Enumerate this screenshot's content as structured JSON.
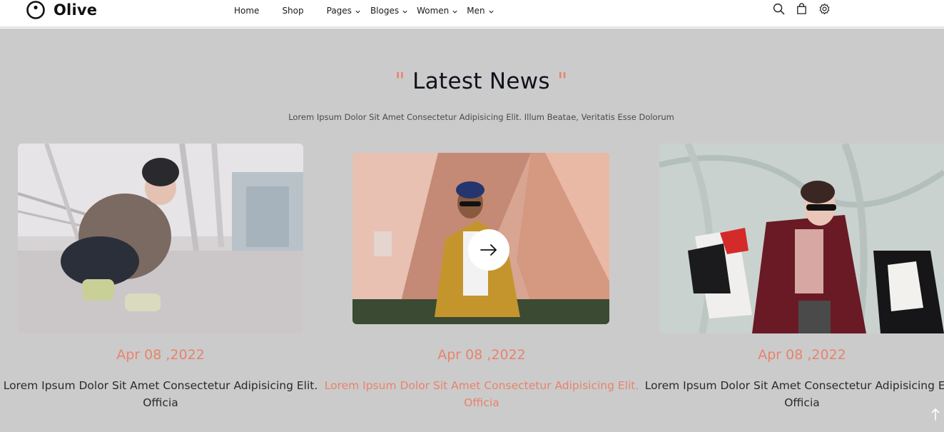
{
  "brand": {
    "name": "Olive"
  },
  "nav": {
    "items": [
      {
        "label": "Home"
      },
      {
        "label": "Shop"
      },
      {
        "label": "Pages"
      },
      {
        "label": "Bloges"
      },
      {
        "label": "Women"
      },
      {
        "label": "Men"
      }
    ]
  },
  "header_icons": [
    "search-icon",
    "shopping-bag-icon",
    "settings-gear-icon"
  ],
  "section": {
    "quote_open": "\"",
    "title": "Latest News",
    "quote_close": "\"",
    "subtitle": "Lorem Ipsum Dolor Sit Amet Consectetur Adipisicing Elit. Illum Beatae, Veritatis Esse Dolorum"
  },
  "cards": [
    {
      "date": "Apr 08 ,2022",
      "text": "Lorem Ipsum Dolor Sit Amet Consectetur Adipisicing Elit. Officia"
    },
    {
      "date": "Apr 08 ,2022",
      "text": "Lorem Ipsum Dolor Sit Amet Consectetur Adipisicing Elit. Officia"
    },
    {
      "date": "Apr 08 ,2022",
      "text": "Lorem Ipsum Dolor Sit Amet Consectetur Adipisicing Elit. Officia"
    }
  ],
  "colors": {
    "accent": "#e8836c",
    "background": "#cbcbcb",
    "heading": "#10121c"
  }
}
